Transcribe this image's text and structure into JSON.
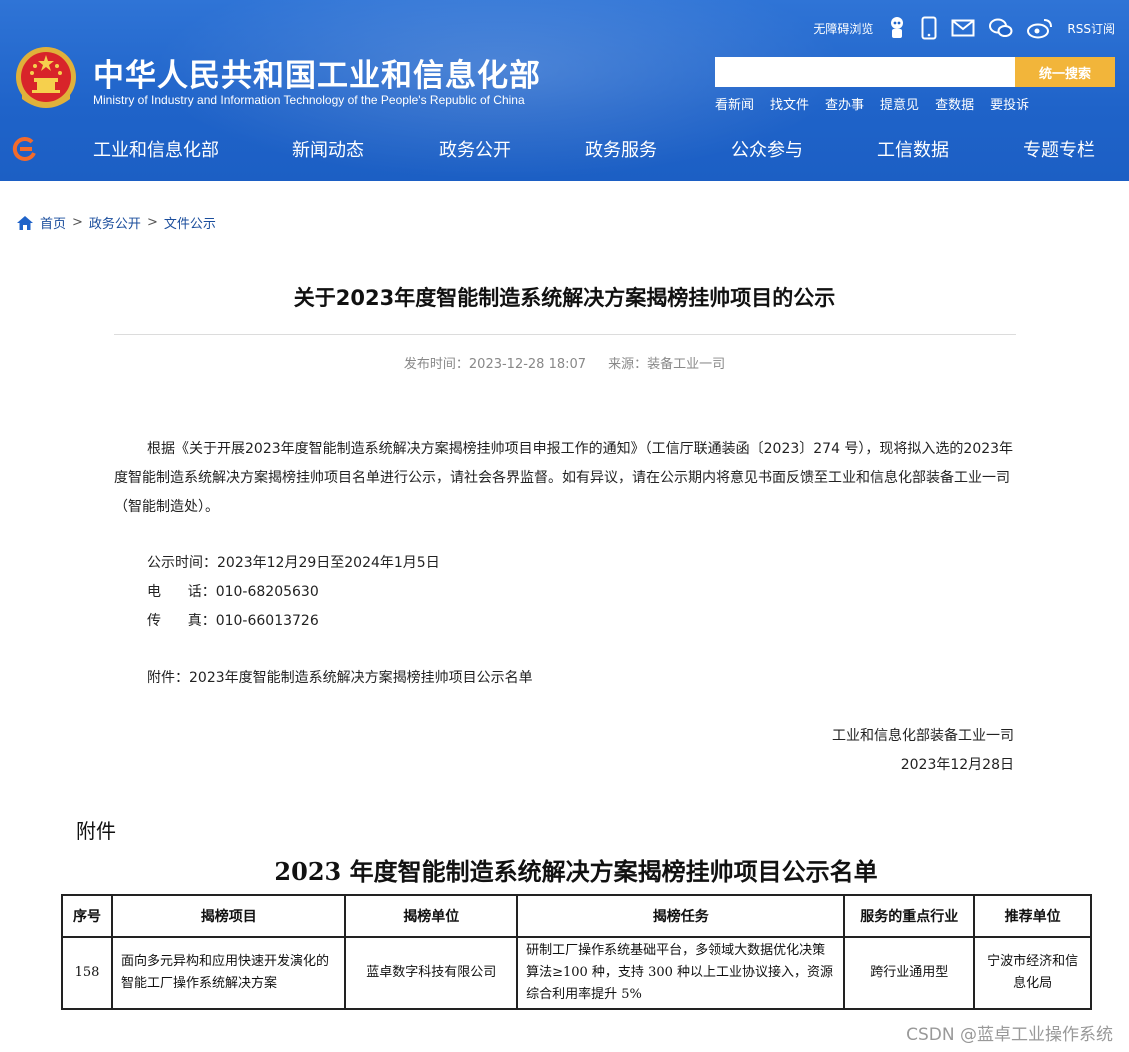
{
  "header": {
    "site_title": "中华人民共和国工业和信息化部",
    "site_subtitle": "Ministry of Industry and Information Technology of the People's Republic of China",
    "accessibility_label": "无障碍浏览",
    "rss_label": "RSS订阅",
    "search_placeholder": "",
    "search_button": "统一搜索",
    "quick_links": [
      "看新闻",
      "找文件",
      "查办事",
      "提意见",
      "查数据",
      "要投诉"
    ],
    "nav": [
      "工业和信息化部",
      "新闻动态",
      "政务公开",
      "政务服务",
      "公众参与",
      "工信数据",
      "专题专栏"
    ],
    "colors": {
      "header_blue": "#1f63c9",
      "search_accent": "#f2b53a"
    }
  },
  "breadcrumb": {
    "home": "首页",
    "sep": ">",
    "level1": "政务公开",
    "level2": "文件公示"
  },
  "article": {
    "title": "关于2023年度智能制造系统解决方案揭榜挂帅项目的公示",
    "publish_time": "发布时间：2023-12-28 18:07",
    "source": "来源：装备工业一司",
    "paragraph": "根据《关于开展2023年度智能制造系统解决方案揭榜挂帅项目申报工作的通知》（工信厅联通装函〔2023〕274 号），现将拟入选的2023年度智能制造系统解决方案揭榜挂帅项目名单进行公示，请社会各界监督。如有异议，请在公示期内将意见书面反馈至工业和信息化部装备工业一司（智能制造处）。",
    "notice_period": "公示时间：2023年12月29日至2024年1月5日",
    "phone": "电      话：010-68205630",
    "fax": "传      真：010-66013726",
    "attachment_line": "附件：2023年度智能制造系统解决方案揭榜挂帅项目公示名单",
    "signature_org": "工业和信息化部装备工业一司",
    "signature_date": "2023年12月28日"
  },
  "attachment": {
    "label": "附件",
    "title": "2023 年度智能制造系统解决方案揭榜挂帅项目公示名单",
    "columns": [
      "序号",
      "揭榜项目",
      "揭榜单位",
      "揭榜任务",
      "服务的重点行业",
      "推荐单位"
    ],
    "rows": [
      {
        "no": "158",
        "project": "面向多元异构和应用快速开发演化的智能工厂操作系统解决方案",
        "unit": "蓝卓数字科技有限公司",
        "task": "研制工厂操作系统基础平台，多领域大数据优化决策算法≥100 种，支持 300 种以上工业协议接入，资源综合利用率提升 5%",
        "industry": "跨行业通用型",
        "recommender": "宁波市经济和信息化局"
      }
    ]
  },
  "watermark": "CSDN @蓝卓工业操作系统"
}
